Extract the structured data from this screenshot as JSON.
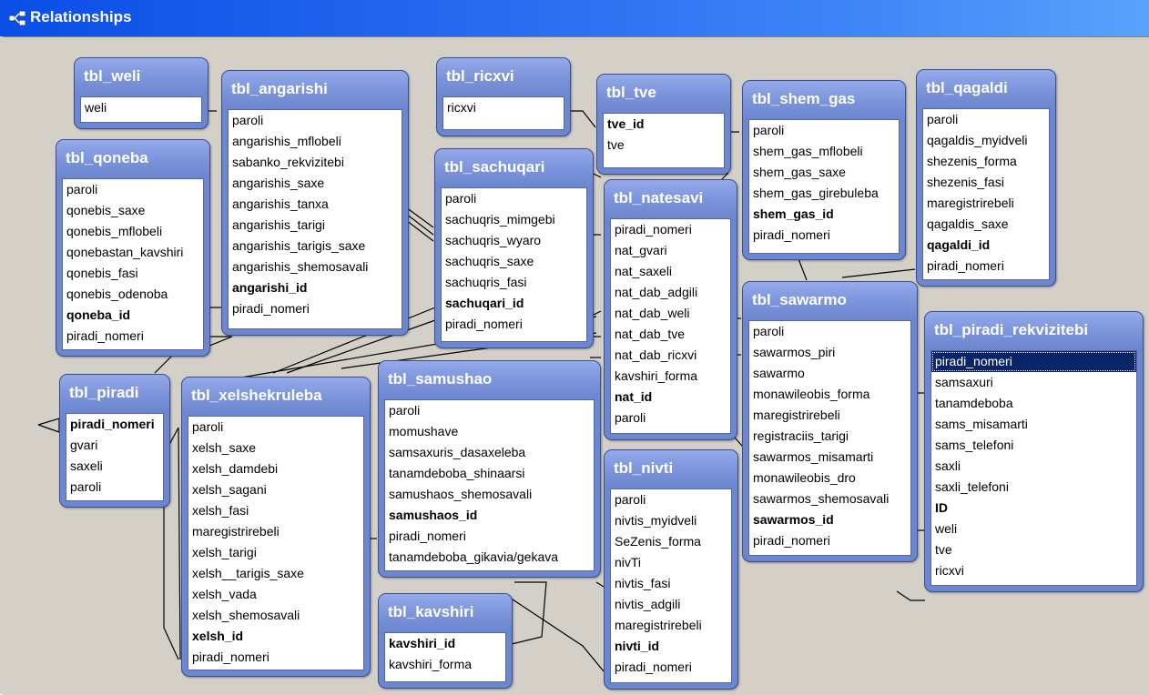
{
  "window": {
    "title": "Relationships",
    "icon": "relationships-icon"
  },
  "colors": {
    "title_bar": "#0a4ee6",
    "table_header": "#6c86cf",
    "selection": "#0a246a",
    "background": "#d4d0c8"
  },
  "tables": {
    "weli": {
      "name": "tbl_weli",
      "fields": [
        {
          "name": "weli",
          "key": false
        }
      ]
    },
    "angarishi": {
      "name": "tbl_angarishi",
      "fields": [
        {
          "name": "paroli",
          "key": false
        },
        {
          "name": "angarishis_mflobeli",
          "key": false
        },
        {
          "name": "sabanko_rekvizitebi",
          "key": false
        },
        {
          "name": "angarishis_saxe",
          "key": false
        },
        {
          "name": "angarishis_tanxa",
          "key": false
        },
        {
          "name": "angarishis_tarigi",
          "key": false
        },
        {
          "name": "angarishis_tarigis_saxe",
          "key": false
        },
        {
          "name": "angarishis_shemosavali",
          "key": false
        },
        {
          "name": "angarishi_id",
          "key": true
        },
        {
          "name": "piradi_nomeri",
          "key": false
        }
      ]
    },
    "ricxvi": {
      "name": "tbl_ricxvi",
      "fields": [
        {
          "name": "ricxvi",
          "key": false
        }
      ]
    },
    "tve": {
      "name": "tbl_tve",
      "fields": [
        {
          "name": "tve_id",
          "key": true
        },
        {
          "name": "tve",
          "key": false
        }
      ]
    },
    "shem_gas": {
      "name": "tbl_shem_gas",
      "fields": [
        {
          "name": "paroli",
          "key": false
        },
        {
          "name": "shem_gas_mflobeli",
          "key": false
        },
        {
          "name": "shem_gas_saxe",
          "key": false
        },
        {
          "name": "shem_gas_girebuleba",
          "key": false
        },
        {
          "name": "shem_gas_id",
          "key": true
        },
        {
          "name": "piradi_nomeri",
          "key": false
        }
      ]
    },
    "qagaldi": {
      "name": "tbl_qagaldi",
      "fields": [
        {
          "name": "paroli",
          "key": false
        },
        {
          "name": "qagaldis_myidveli",
          "key": false
        },
        {
          "name": "shezenis_forma",
          "key": false
        },
        {
          "name": "shezenis_fasi",
          "key": false
        },
        {
          "name": "maregistrirebeli",
          "key": false
        },
        {
          "name": "qagaldis_saxe",
          "key": false
        },
        {
          "name": "qagaldi_id",
          "key": true
        },
        {
          "name": "piradi_nomeri",
          "key": false
        }
      ]
    },
    "qoneba": {
      "name": "tbl_qoneba",
      "fields": [
        {
          "name": "paroli",
          "key": false
        },
        {
          "name": "qonebis_saxe",
          "key": false
        },
        {
          "name": "qonebis_mflobeli",
          "key": false
        },
        {
          "name": "qonebastan_kavshiri",
          "key": false
        },
        {
          "name": "qonebis_fasi",
          "key": false
        },
        {
          "name": "qonebis_odenoba",
          "key": false
        },
        {
          "name": "qoneba_id",
          "key": true
        },
        {
          "name": "piradi_nomeri",
          "key": false
        }
      ]
    },
    "sachuqari": {
      "name": "tbl_sachuqari",
      "fields": [
        {
          "name": "paroli",
          "key": false
        },
        {
          "name": "sachuqris_mimgebi",
          "key": false
        },
        {
          "name": "sachuqris_wyaro",
          "key": false
        },
        {
          "name": "sachuqris_saxe",
          "key": false
        },
        {
          "name": "sachuqris_fasi",
          "key": false
        },
        {
          "name": "sachuqari_id",
          "key": true
        },
        {
          "name": "piradi_nomeri",
          "key": false
        }
      ]
    },
    "natesavi": {
      "name": "tbl_natesavi",
      "fields": [
        {
          "name": "piradi_nomeri",
          "key": false
        },
        {
          "name": "nat_gvari",
          "key": false
        },
        {
          "name": "nat_saxeli",
          "key": false
        },
        {
          "name": "nat_dab_adgili",
          "key": false
        },
        {
          "name": "nat_dab_weli",
          "key": false
        },
        {
          "name": "nat_dab_tve",
          "key": false
        },
        {
          "name": "nat_dab_ricxvi",
          "key": false
        },
        {
          "name": "kavshiri_forma",
          "key": false
        },
        {
          "name": "nat_id",
          "key": true
        },
        {
          "name": "paroli",
          "key": false
        }
      ]
    },
    "sawarmo": {
      "name": "tbl_sawarmo",
      "fields": [
        {
          "name": "paroli",
          "key": false
        },
        {
          "name": "sawarmos_piri",
          "key": false
        },
        {
          "name": "sawarmo",
          "key": false
        },
        {
          "name": "monawileobis_forma",
          "key": false
        },
        {
          "name": "maregistrirebeli",
          "key": false
        },
        {
          "name": "registraciis_tarigi",
          "key": false
        },
        {
          "name": "sawarmos_misamarti",
          "key": false
        },
        {
          "name": "monawileobis_dro",
          "key": false
        },
        {
          "name": "sawarmos_shemosavali",
          "key": false
        },
        {
          "name": "sawarmos_id",
          "key": true
        },
        {
          "name": "piradi_nomeri",
          "key": false
        }
      ]
    },
    "piradi_rekvizitebi": {
      "name": "tbl_piradi_rekvizitebi",
      "fields": [
        {
          "name": "piradi_nomeri",
          "key": false,
          "selected": true
        },
        {
          "name": "samsaxuri",
          "key": false
        },
        {
          "name": "tanamdeboba",
          "key": false
        },
        {
          "name": "sams_misamarti",
          "key": false
        },
        {
          "name": "sams_telefoni",
          "key": false
        },
        {
          "name": "saxli",
          "key": false
        },
        {
          "name": "saxli_telefoni",
          "key": false
        },
        {
          "name": "ID",
          "key": true
        },
        {
          "name": "weli",
          "key": false
        },
        {
          "name": "tve",
          "key": false
        },
        {
          "name": "ricxvi",
          "key": false
        }
      ]
    },
    "piradi": {
      "name": "tbl_piradi",
      "fields": [
        {
          "name": "piradi_nomeri",
          "key": true
        },
        {
          "name": "gvari",
          "key": false
        },
        {
          "name": "saxeli",
          "key": false
        },
        {
          "name": "paroli",
          "key": false
        }
      ]
    },
    "xelshekruleba": {
      "name": "tbl_xelshekruleba",
      "fields": [
        {
          "name": "paroli",
          "key": false
        },
        {
          "name": "xelsh_saxe",
          "key": false
        },
        {
          "name": "xelsh_damdebi",
          "key": false
        },
        {
          "name": "xelsh_sagani",
          "key": false
        },
        {
          "name": "xelsh_fasi",
          "key": false
        },
        {
          "name": "maregistrirebeli",
          "key": false
        },
        {
          "name": "xelsh_tarigi",
          "key": false
        },
        {
          "name": "xelsh__tarigis_saxe",
          "key": false
        },
        {
          "name": "xelsh_vada",
          "key": false
        },
        {
          "name": "xelsh_shemosavali",
          "key": false
        },
        {
          "name": "xelsh_id",
          "key": true
        },
        {
          "name": "piradi_nomeri",
          "key": false
        }
      ]
    },
    "samushao": {
      "name": "tbl_samushao",
      "fields": [
        {
          "name": "paroli",
          "key": false
        },
        {
          "name": "momushave",
          "key": false
        },
        {
          "name": "samsaxuris_dasaxeleba",
          "key": false
        },
        {
          "name": "tanamdeboba_shinaarsi",
          "key": false
        },
        {
          "name": "samushaos_shemosavali",
          "key": false
        },
        {
          "name": "samushaos_id",
          "key": true
        },
        {
          "name": "piradi_nomeri",
          "key": false
        },
        {
          "name": "tanamdeboba_gikavia/gekava",
          "key": false
        }
      ]
    },
    "nivti": {
      "name": "tbl_nivti",
      "fields": [
        {
          "name": "paroli",
          "key": false
        },
        {
          "name": "nivtis_myidveli",
          "key": false
        },
        {
          "name": "SeZenis_forma",
          "key": false
        },
        {
          "name": "nivTi",
          "key": false
        },
        {
          "name": "nivtis_fasi",
          "key": false
        },
        {
          "name": "nivtis_adgili",
          "key": false
        },
        {
          "name": "maregistrirebeli",
          "key": false
        },
        {
          "name": "nivti_id",
          "key": true
        },
        {
          "name": "piradi_nomeri",
          "key": false
        }
      ]
    },
    "kavshiri": {
      "name": "tbl_kavshiri",
      "fields": [
        {
          "name": "kavshiri_id",
          "key": true
        },
        {
          "name": "kavshiri_forma",
          "key": false
        }
      ]
    }
  }
}
